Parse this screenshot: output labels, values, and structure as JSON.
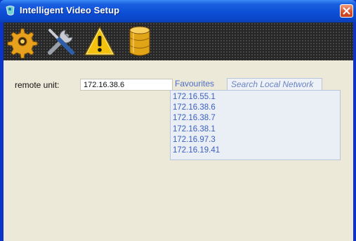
{
  "window": {
    "title": "Intelligent Video Setup"
  },
  "toolbar": {
    "tools": [
      {
        "icon": "gear-icon"
      },
      {
        "icon": "tools-icon"
      },
      {
        "icon": "warning-icon"
      },
      {
        "icon": "database-icon"
      }
    ]
  },
  "form": {
    "remote_unit_label": "remote unit:",
    "remote_unit_value": "172.16.38.6"
  },
  "tabs": {
    "favourites": "Favourites",
    "search": "Search Local Network"
  },
  "favourites": [
    "172.16.55.1",
    "172.16.38.6",
    "172.16.38.7",
    "172.16.38.1",
    "172.16.97.3",
    "172.16.19.41"
  ],
  "colors": {
    "titlebar": "#0a46c8",
    "client_bg": "#ece9d8",
    "link": "#3a5fc0"
  }
}
